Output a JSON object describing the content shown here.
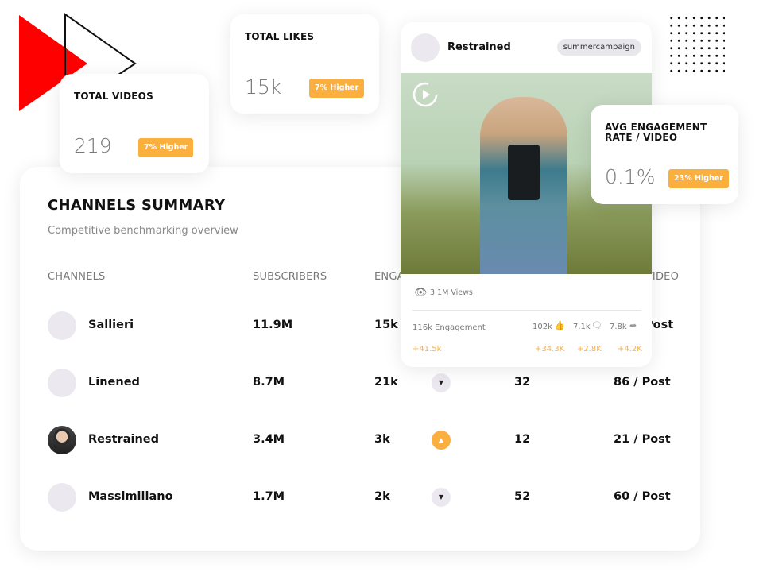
{
  "stats": {
    "total_videos": {
      "title": "TOTAL VIDEOS",
      "value": "219",
      "badge": "7% Higher"
    },
    "total_likes": {
      "title": "TOTAL LIKES",
      "value": "15k",
      "badge": "7% Higher"
    },
    "avg_engagement": {
      "title": "AVG ENGAGEMENT RATE / VIDEO",
      "value": "0.1%",
      "badge": "23% Higher"
    }
  },
  "summary": {
    "title": "CHANNELS SUMMARY",
    "subtitle": "Competitive benchmarking overview",
    "headers": [
      "CHANNELS",
      "SUBSCRIBERS",
      "ENGAGEMENT",
      "VIDEO"
    ],
    "rows": [
      {
        "name": "Sallieri",
        "subscribers": "11.9M",
        "engagement": "15k",
        "trend": "",
        "count": "",
        "per_video": "Post",
        "has_photo": false
      },
      {
        "name": "Linened",
        "subscribers": "8.7M",
        "engagement": "21k",
        "trend": "down",
        "count": "32",
        "per_video": "86 / Post",
        "has_photo": false
      },
      {
        "name": "Restrained",
        "subscribers": "3.4M",
        "engagement": "3k",
        "trend": "up",
        "count": "12",
        "per_video": "21 / Post",
        "has_photo": true
      },
      {
        "name": "Massimiliano",
        "subscribers": "1.7M",
        "engagement": "2k",
        "trend": "down",
        "count": "52",
        "per_video": "60 / Post",
        "has_photo": false
      }
    ]
  },
  "post": {
    "channel": "Restrained",
    "tag": "summercampaign",
    "views": "3.1M Views",
    "engagement": "116k Engagement",
    "likes": "102k",
    "comments": "7.1k",
    "shares": "7.8k",
    "engagement_delta": "+41.5k",
    "likes_delta": "+34.3K",
    "comments_delta": "+2.8K",
    "shares_delta": "+4.2K"
  },
  "colors": {
    "accent": "#fbaf3f",
    "brand_red": "#ff0000"
  }
}
